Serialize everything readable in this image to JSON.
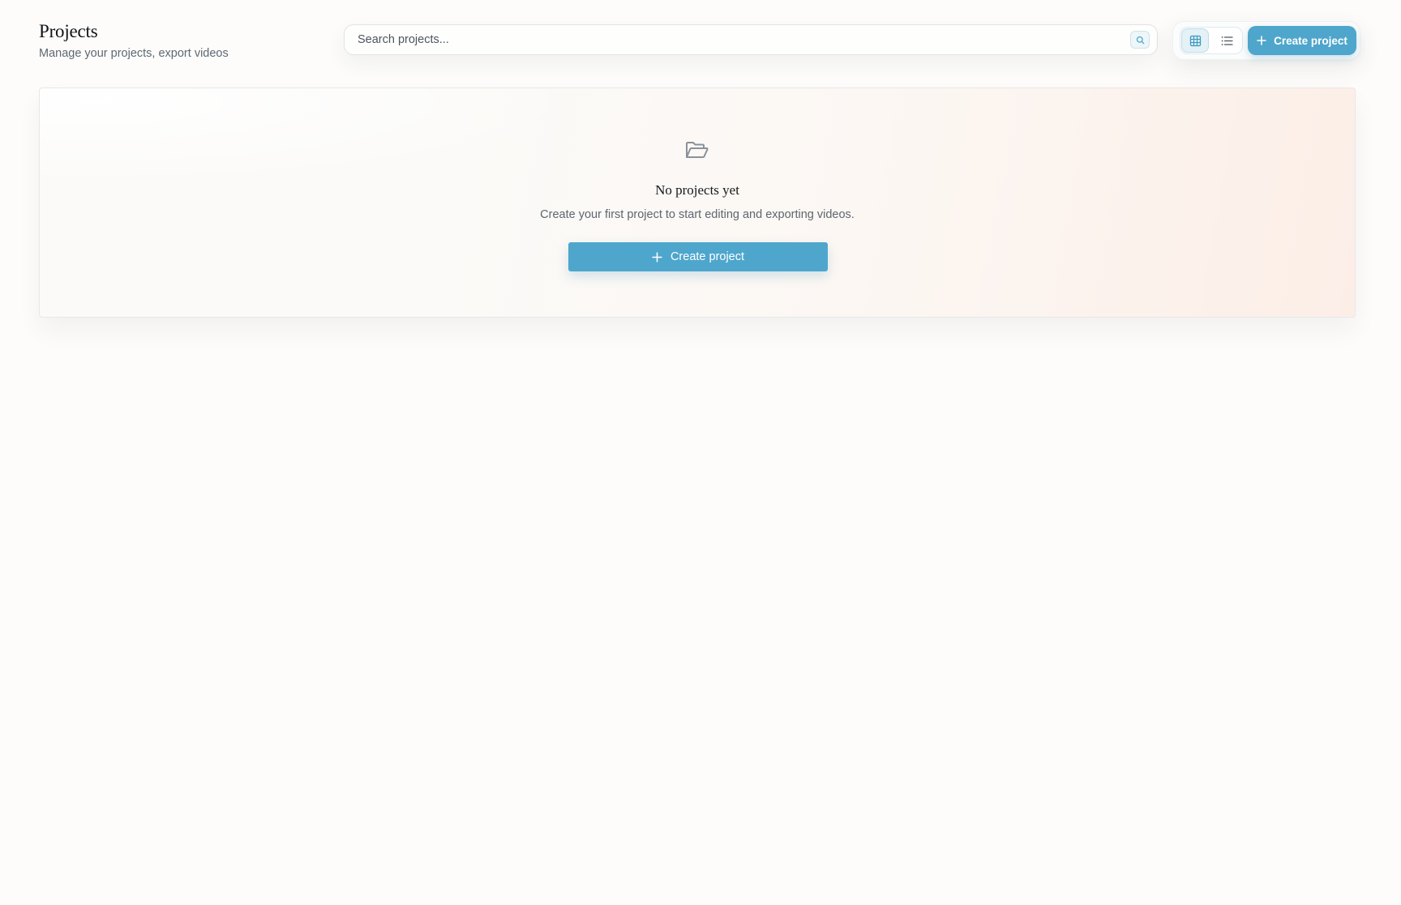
{
  "header": {
    "title": "Projects",
    "subtitle": "Manage your projects, export videos"
  },
  "search": {
    "placeholder": "Search projects...",
    "value": "",
    "icon": "search-icon"
  },
  "toolbar": {
    "view_modes": [
      {
        "name": "grid",
        "icon": "grid-icon",
        "active": true
      },
      {
        "name": "list",
        "icon": "list-icon",
        "active": false
      }
    ],
    "create_label": "Create project",
    "create_icon": "plus-icon"
  },
  "empty_state": {
    "icon": "folder-open-icon",
    "title": "No projects yet",
    "description": "Create your first project to start editing and exporting videos.",
    "button_label": "Create project",
    "button_icon": "plus-icon"
  },
  "colors": {
    "accent": "#4ea6cc",
    "background": "#fdfcfa",
    "muted_text": "#5d6670"
  }
}
